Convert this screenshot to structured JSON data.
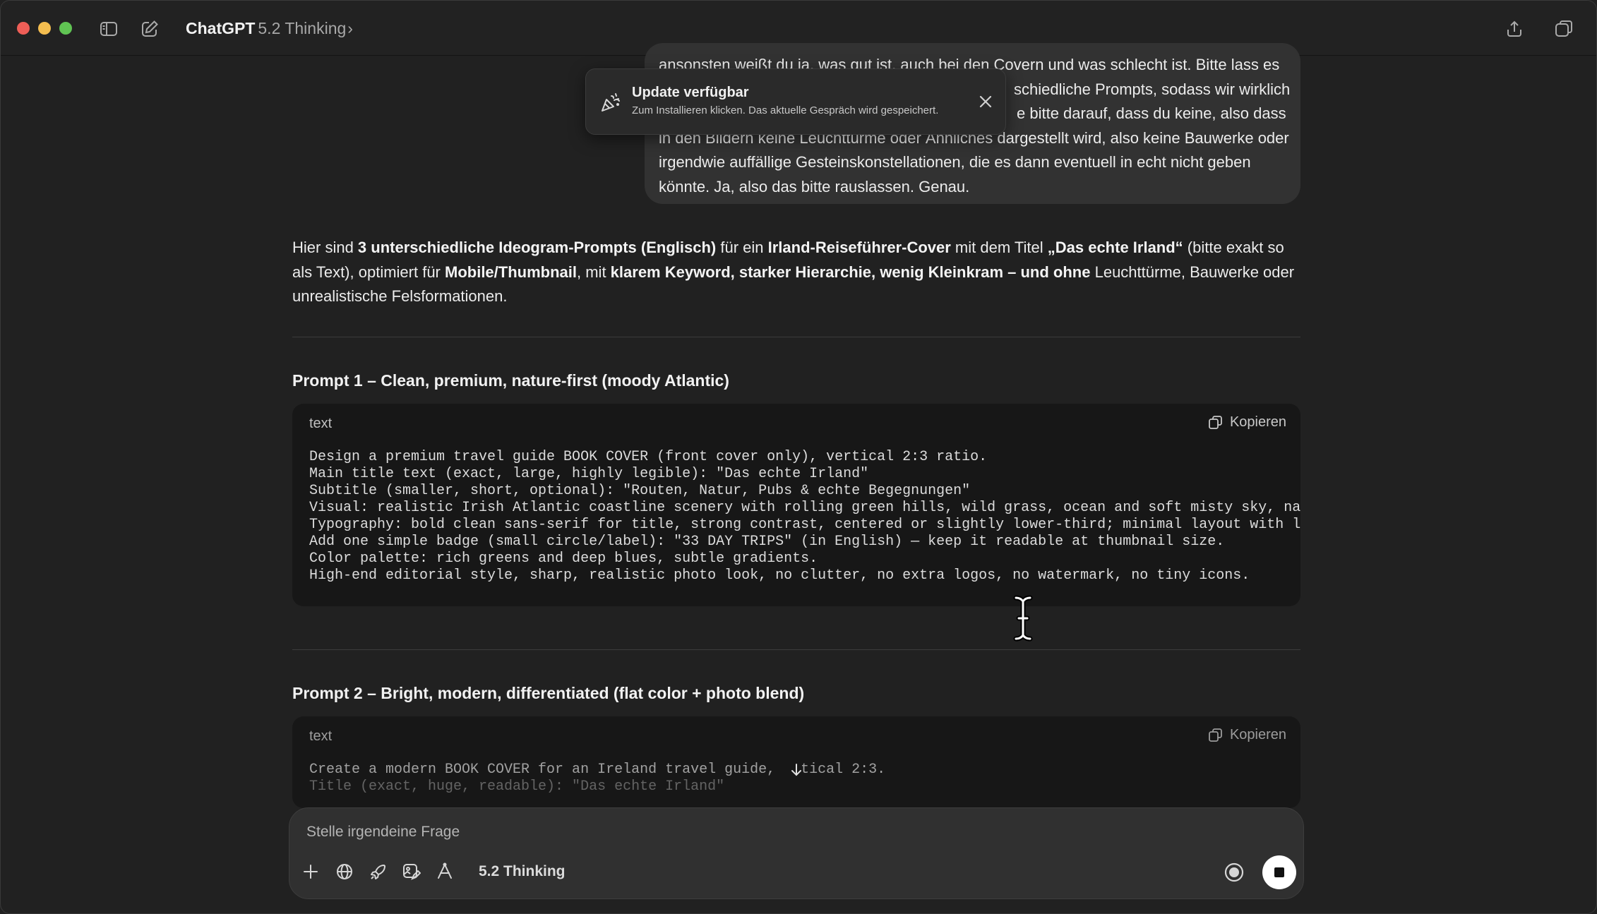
{
  "titlebar": {
    "app_name": "ChatGPT",
    "model": "5.2 Thinking",
    "chevron": "›",
    "icons": [
      "sidebar-toggle-icon",
      "new-chat-icon",
      "share-icon",
      "window-icon"
    ]
  },
  "user_message": {
    "lines": [
      "ansonsten weißt du ja, was gut ist, auch bei den Covern und was schlecht ist. Bitte lass es",
      "schiedliche Prompts, sodass wir wirklich",
      "e bitte darauf, dass du keine, also dass",
      "in den Bildern keine Leuchttürme oder Ähnliches dargestellt wird, also keine Bauwerke oder",
      "irgendwie auffällige Gesteinskonstellationen, die es dann eventuell in echt nicht geben",
      "könnte. Ja, also das bitte rauslassen. Genau."
    ]
  },
  "toast": {
    "title": "Update verfügbar",
    "subtitle": "Zum Installieren klicken. Das aktuelle Gespräch wird gespeichert.",
    "icon": "party-popper-icon"
  },
  "intro": {
    "l1_a": "Hier sind ",
    "l1_b": "3 unterschiedliche Ideogram-Prompts (Englisch)",
    "l1_c": " für ein ",
    "l1_d": "Irland-Reiseführer-Cover",
    "l1_e": " mit dem Titel ",
    "l1_f": "„Das echte Irland“",
    "l1_g": " (bitte exakt so",
    "l2_a": "als Text), optimiert für ",
    "l2_b": "Mobile/Thumbnail",
    "l2_c": ", mit ",
    "l2_d": "klarem Keyword, starker Hierarchie, wenig Kleinkram – und ohne",
    "l2_e": " Leuchttürme, Bauwerke oder",
    "l3": "unrealistische Felsformationen."
  },
  "prompt1": {
    "heading": "Prompt 1 – Clean, premium, nature-first (moody Atlantic)",
    "lang": "text",
    "copy_label": "Kopieren",
    "code": "Design a premium travel guide BOOK COVER (front cover only), vertical 2:3 ratio.\nMain title text (exact, large, highly legible): \"Das echte Irland\"\nSubtitle (smaller, short, optional): \"Routen, Natur, Pubs & echte Begegnungen\"\nVisual: realistic Irish Atlantic coastline scenery with rolling green hills, wild grass, ocean and soft misty sky, na\nTypography: bold clean sans-serif for title, strong contrast, centered or slightly lower-third; minimal layout with l\nAdd one simple badge (small circle/label): \"33 DAY TRIPS\" (in English) — keep it readable at thumbnail size.\nColor palette: rich greens and deep blues, subtle gradients.\nHigh-end editorial style, sharp, realistic photo look, no clutter, no extra logos, no watermark, no tiny icons."
  },
  "prompt2": {
    "heading": "Prompt 2 – Bright, modern, differentiated (flat color + photo blend)",
    "lang": "text",
    "copy_label": "Kopieren",
    "line1": "Create a modern BOOK COVER for an Ireland travel guide,   tical 2:3.",
    "line2": "Title (exact, huge, readable): \"Das echte Irland\""
  },
  "composer": {
    "placeholder": "Stelle irgendeine Frage",
    "model_label": "5.2 Thinking",
    "icons": [
      "plus-icon",
      "globe-icon",
      "rocket-icon",
      "image-edit-icon",
      "tools-icon",
      "voice-icon",
      "stop-icon"
    ]
  },
  "colors": {
    "background": "#212121",
    "bubble": "#323232",
    "code_bg": "#171717",
    "composer_bg": "#303030"
  }
}
